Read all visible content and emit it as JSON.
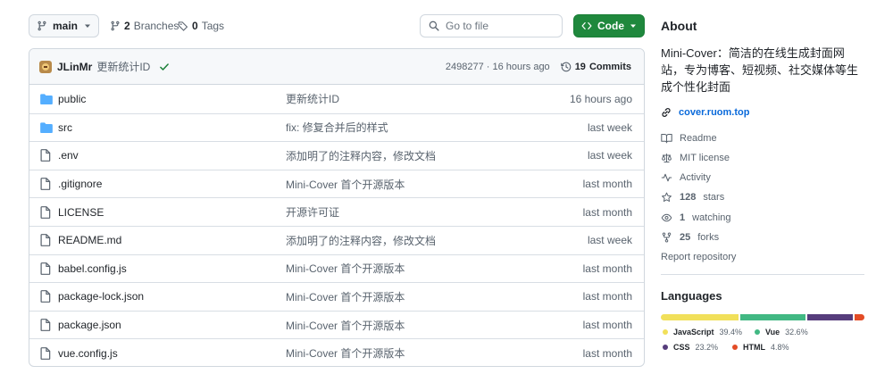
{
  "colors": {
    "accent": "#1f883d",
    "link": "#0969da",
    "folder": "#54aeff",
    "check": "#1a7f37"
  },
  "toolbar": {
    "branch_label": "main",
    "branches_count": "2",
    "branches_label": "Branches",
    "tags_count": "0",
    "tags_label": "Tags",
    "goto_placeholder": "Go to file",
    "code_label": "Code"
  },
  "commit": {
    "author": "JLinMr",
    "message": "更新统计ID",
    "hash_time": "2498277 · 16 hours ago",
    "commits_count": "19",
    "commits_label": "Commits"
  },
  "files": [
    {
      "type": "folder",
      "name": "public",
      "message": "更新统计ID",
      "date": "16 hours ago"
    },
    {
      "type": "folder",
      "name": "src",
      "message": "fix: 修复合并后的样式",
      "date": "last week"
    },
    {
      "type": "file",
      "name": ".env",
      "message": "添加明了的注释内容，修改文档",
      "date": "last week"
    },
    {
      "type": "file",
      "name": ".gitignore",
      "message": "Mini-Cover 首个开源版本",
      "date": "last month"
    },
    {
      "type": "file",
      "name": "LICENSE",
      "message": "开源许可证",
      "date": "last month"
    },
    {
      "type": "file",
      "name": "README.md",
      "message": "添加明了的注释内容，修改文档",
      "date": "last week"
    },
    {
      "type": "file",
      "name": "babel.config.js",
      "message": "Mini-Cover 首个开源版本",
      "date": "last month"
    },
    {
      "type": "file",
      "name": "package-lock.json",
      "message": "Mini-Cover 首个开源版本",
      "date": "last month"
    },
    {
      "type": "file",
      "name": "package.json",
      "message": "Mini-Cover 首个开源版本",
      "date": "last month"
    },
    {
      "type": "file",
      "name": "vue.config.js",
      "message": "Mini-Cover 首个开源版本",
      "date": "last month"
    }
  ],
  "about": {
    "title": "About",
    "description": "Mini-Cover：简洁的在线生成封面网站，专为博客、短视频、社交媒体等生成个性化封面",
    "website": "cover.ruom.top",
    "readme": "Readme",
    "license": "MIT license",
    "activity": "Activity",
    "stars_count": "128",
    "stars_label": "stars",
    "watching_count": "1",
    "watching_label": "watching",
    "forks_count": "25",
    "forks_label": "forks",
    "report": "Report repository"
  },
  "languages": {
    "title": "Languages",
    "items": [
      {
        "name": "JavaScript",
        "percent": "39.4%",
        "value": 39.4,
        "color": "#f1e05a"
      },
      {
        "name": "Vue",
        "percent": "32.6%",
        "value": 32.6,
        "color": "#41b883"
      },
      {
        "name": "CSS",
        "percent": "23.2%",
        "value": 23.2,
        "color": "#563d7c"
      },
      {
        "name": "HTML",
        "percent": "4.8%",
        "value": 4.8,
        "color": "#e34c26"
      }
    ]
  }
}
